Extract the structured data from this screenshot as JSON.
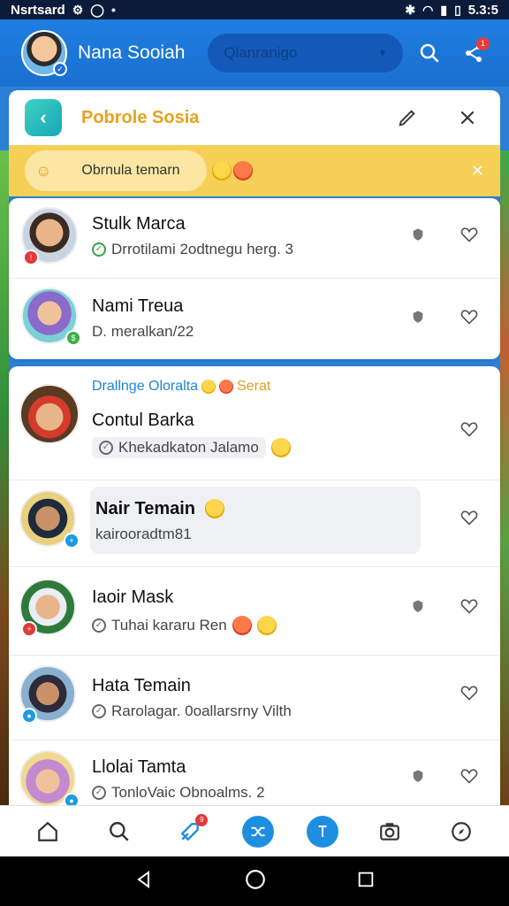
{
  "status_bar": {
    "carrier": "Nsrtsard",
    "time": "5.3:5"
  },
  "header": {
    "user_name": "Nana Sooiah",
    "search_placeholder": "Qlanranigo",
    "notification_count": "1"
  },
  "panel": {
    "title": "Pobrole Sosia"
  },
  "banner": {
    "chip_label": "Obrnula temarn"
  },
  "contacts_top": [
    {
      "name": "Stulk Marca",
      "sub": "Drrotilami 2odtnegu herg. 3",
      "check": "green"
    },
    {
      "name": "Nami Treua",
      "sub": "D. meralkan/22",
      "check": "none"
    }
  ],
  "highlight_label": {
    "text": "Drallnge Oloralta",
    "extra": "Serat"
  },
  "contacts_bottom": [
    {
      "name": "Contul Barka",
      "sub": "Khekadkaton Jalamo"
    },
    {
      "name": "Nair Temain",
      "sub": "kairooradtm81"
    },
    {
      "name": "Iaoir Mask",
      "sub": "Tuhai kararu Ren"
    },
    {
      "name": "Hata Temain",
      "sub": "Rarolagar. 0oallarsrny Vilth"
    },
    {
      "name": "Llolai Tamta",
      "sub": "TonloVaic Obnoalms. 2"
    }
  ],
  "nav_badge": "9",
  "colors": {
    "primary": "#1e7fe0",
    "banner": "#f6cf57",
    "title_accent": "#e8a21c",
    "link": "#1f84d6"
  }
}
